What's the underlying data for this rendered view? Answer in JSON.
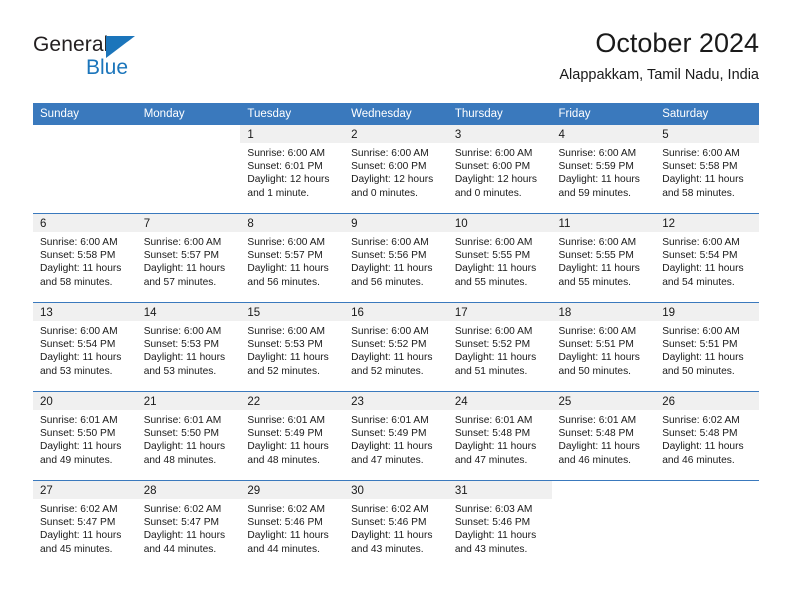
{
  "brand": {
    "name_part1": "General",
    "name_part2": "Blue",
    "logo_icon": "triangle-logo-icon"
  },
  "header": {
    "month_title": "October 2024",
    "location": "Alappakkam, Tamil Nadu, India"
  },
  "colors": {
    "header_blue": "#3a79bd",
    "brand_blue": "#1b75bb",
    "daynum_band": "#f0f0f0",
    "text": "#1a1a1a"
  },
  "weekday_headers": [
    "Sunday",
    "Monday",
    "Tuesday",
    "Wednesday",
    "Thursday",
    "Friday",
    "Saturday"
  ],
  "weeks": [
    [
      {
        "day": "",
        "blank": true,
        "sunrise": "",
        "sunset": "",
        "daylight1": "",
        "daylight2": ""
      },
      {
        "day": "",
        "blank": true,
        "sunrise": "",
        "sunset": "",
        "daylight1": "",
        "daylight2": ""
      },
      {
        "day": "1",
        "sunrise": "Sunrise: 6:00 AM",
        "sunset": "Sunset: 6:01 PM",
        "daylight1": "Daylight: 12 hours",
        "daylight2": "and 1 minute."
      },
      {
        "day": "2",
        "sunrise": "Sunrise: 6:00 AM",
        "sunset": "Sunset: 6:00 PM",
        "daylight1": "Daylight: 12 hours",
        "daylight2": "and 0 minutes."
      },
      {
        "day": "3",
        "sunrise": "Sunrise: 6:00 AM",
        "sunset": "Sunset: 6:00 PM",
        "daylight1": "Daylight: 12 hours",
        "daylight2": "and 0 minutes."
      },
      {
        "day": "4",
        "sunrise": "Sunrise: 6:00 AM",
        "sunset": "Sunset: 5:59 PM",
        "daylight1": "Daylight: 11 hours",
        "daylight2": "and 59 minutes."
      },
      {
        "day": "5",
        "sunrise": "Sunrise: 6:00 AM",
        "sunset": "Sunset: 5:58 PM",
        "daylight1": "Daylight: 11 hours",
        "daylight2": "and 58 minutes."
      }
    ],
    [
      {
        "day": "6",
        "sunrise": "Sunrise: 6:00 AM",
        "sunset": "Sunset: 5:58 PM",
        "daylight1": "Daylight: 11 hours",
        "daylight2": "and 58 minutes."
      },
      {
        "day": "7",
        "sunrise": "Sunrise: 6:00 AM",
        "sunset": "Sunset: 5:57 PM",
        "daylight1": "Daylight: 11 hours",
        "daylight2": "and 57 minutes."
      },
      {
        "day": "8",
        "sunrise": "Sunrise: 6:00 AM",
        "sunset": "Sunset: 5:57 PM",
        "daylight1": "Daylight: 11 hours",
        "daylight2": "and 56 minutes."
      },
      {
        "day": "9",
        "sunrise": "Sunrise: 6:00 AM",
        "sunset": "Sunset: 5:56 PM",
        "daylight1": "Daylight: 11 hours",
        "daylight2": "and 56 minutes."
      },
      {
        "day": "10",
        "sunrise": "Sunrise: 6:00 AM",
        "sunset": "Sunset: 5:55 PM",
        "daylight1": "Daylight: 11 hours",
        "daylight2": "and 55 minutes."
      },
      {
        "day": "11",
        "sunrise": "Sunrise: 6:00 AM",
        "sunset": "Sunset: 5:55 PM",
        "daylight1": "Daylight: 11 hours",
        "daylight2": "and 55 minutes."
      },
      {
        "day": "12",
        "sunrise": "Sunrise: 6:00 AM",
        "sunset": "Sunset: 5:54 PM",
        "daylight1": "Daylight: 11 hours",
        "daylight2": "and 54 minutes."
      }
    ],
    [
      {
        "day": "13",
        "sunrise": "Sunrise: 6:00 AM",
        "sunset": "Sunset: 5:54 PM",
        "daylight1": "Daylight: 11 hours",
        "daylight2": "and 53 minutes."
      },
      {
        "day": "14",
        "sunrise": "Sunrise: 6:00 AM",
        "sunset": "Sunset: 5:53 PM",
        "daylight1": "Daylight: 11 hours",
        "daylight2": "and 53 minutes."
      },
      {
        "day": "15",
        "sunrise": "Sunrise: 6:00 AM",
        "sunset": "Sunset: 5:53 PM",
        "daylight1": "Daylight: 11 hours",
        "daylight2": "and 52 minutes."
      },
      {
        "day": "16",
        "sunrise": "Sunrise: 6:00 AM",
        "sunset": "Sunset: 5:52 PM",
        "daylight1": "Daylight: 11 hours",
        "daylight2": "and 52 minutes."
      },
      {
        "day": "17",
        "sunrise": "Sunrise: 6:00 AM",
        "sunset": "Sunset: 5:52 PM",
        "daylight1": "Daylight: 11 hours",
        "daylight2": "and 51 minutes."
      },
      {
        "day": "18",
        "sunrise": "Sunrise: 6:00 AM",
        "sunset": "Sunset: 5:51 PM",
        "daylight1": "Daylight: 11 hours",
        "daylight2": "and 50 minutes."
      },
      {
        "day": "19",
        "sunrise": "Sunrise: 6:00 AM",
        "sunset": "Sunset: 5:51 PM",
        "daylight1": "Daylight: 11 hours",
        "daylight2": "and 50 minutes."
      }
    ],
    [
      {
        "day": "20",
        "sunrise": "Sunrise: 6:01 AM",
        "sunset": "Sunset: 5:50 PM",
        "daylight1": "Daylight: 11 hours",
        "daylight2": "and 49 minutes."
      },
      {
        "day": "21",
        "sunrise": "Sunrise: 6:01 AM",
        "sunset": "Sunset: 5:50 PM",
        "daylight1": "Daylight: 11 hours",
        "daylight2": "and 48 minutes."
      },
      {
        "day": "22",
        "sunrise": "Sunrise: 6:01 AM",
        "sunset": "Sunset: 5:49 PM",
        "daylight1": "Daylight: 11 hours",
        "daylight2": "and 48 minutes."
      },
      {
        "day": "23",
        "sunrise": "Sunrise: 6:01 AM",
        "sunset": "Sunset: 5:49 PM",
        "daylight1": "Daylight: 11 hours",
        "daylight2": "and 47 minutes."
      },
      {
        "day": "24",
        "sunrise": "Sunrise: 6:01 AM",
        "sunset": "Sunset: 5:48 PM",
        "daylight1": "Daylight: 11 hours",
        "daylight2": "and 47 minutes."
      },
      {
        "day": "25",
        "sunrise": "Sunrise: 6:01 AM",
        "sunset": "Sunset: 5:48 PM",
        "daylight1": "Daylight: 11 hours",
        "daylight2": "and 46 minutes."
      },
      {
        "day": "26",
        "sunrise": "Sunrise: 6:02 AM",
        "sunset": "Sunset: 5:48 PM",
        "daylight1": "Daylight: 11 hours",
        "daylight2": "and 46 minutes."
      }
    ],
    [
      {
        "day": "27",
        "sunrise": "Sunrise: 6:02 AM",
        "sunset": "Sunset: 5:47 PM",
        "daylight1": "Daylight: 11 hours",
        "daylight2": "and 45 minutes."
      },
      {
        "day": "28",
        "sunrise": "Sunrise: 6:02 AM",
        "sunset": "Sunset: 5:47 PM",
        "daylight1": "Daylight: 11 hours",
        "daylight2": "and 44 minutes."
      },
      {
        "day": "29",
        "sunrise": "Sunrise: 6:02 AM",
        "sunset": "Sunset: 5:46 PM",
        "daylight1": "Daylight: 11 hours",
        "daylight2": "and 44 minutes."
      },
      {
        "day": "30",
        "sunrise": "Sunrise: 6:02 AM",
        "sunset": "Sunset: 5:46 PM",
        "daylight1": "Daylight: 11 hours",
        "daylight2": "and 43 minutes."
      },
      {
        "day": "31",
        "sunrise": "Sunrise: 6:03 AM",
        "sunset": "Sunset: 5:46 PM",
        "daylight1": "Daylight: 11 hours",
        "daylight2": "and 43 minutes."
      },
      {
        "day": "",
        "blank": true,
        "sunrise": "",
        "sunset": "",
        "daylight1": "",
        "daylight2": ""
      },
      {
        "day": "",
        "blank": true,
        "sunrise": "",
        "sunset": "",
        "daylight1": "",
        "daylight2": ""
      }
    ]
  ]
}
